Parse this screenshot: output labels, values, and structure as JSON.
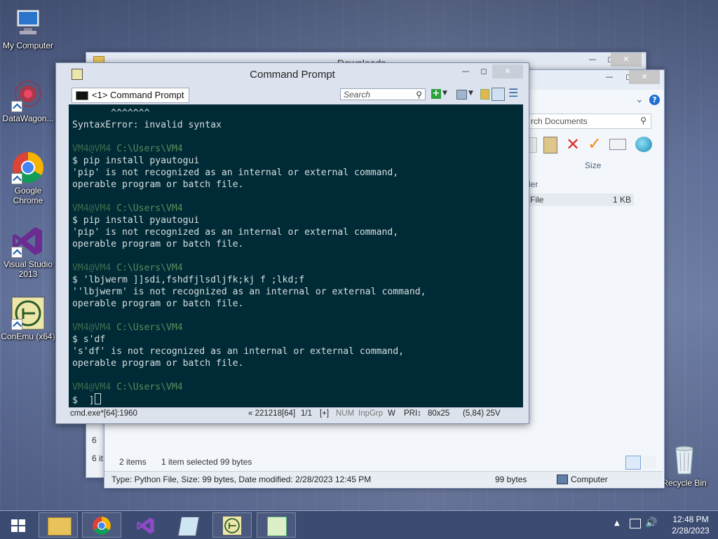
{
  "desktop": {
    "icons": [
      {
        "label": "My Computer",
        "icon": "computer-icon"
      },
      {
        "label": "DataWagon...",
        "icon": "datawagon-icon"
      },
      {
        "label": "Google Chrome",
        "icon": "chrome-icon"
      },
      {
        "label": "Visual Studio 2013",
        "icon": "visual-studio-icon"
      },
      {
        "label": "ConEmu (x64)",
        "icon": "conemu-icon"
      },
      {
        "label": "Recycle Bin",
        "icon": "recycle-bin-icon"
      }
    ]
  },
  "explorer_back": {
    "title": "Downloads",
    "status_items": "6 it",
    "left_label": "6"
  },
  "explorer_front": {
    "search_placeholder": "rch Documents",
    "column_size": "Size",
    "row_group": "ler",
    "row_type": "File",
    "row_size": "1 KB",
    "status_count": "2 items",
    "status_selected": "1 item selected  99 bytes",
    "details_text": "Type: Python File, Size: 99 bytes, Date modified: 2/28/2023 12:45 PM",
    "details_size": "99 bytes",
    "details_location": "Computer"
  },
  "cmd": {
    "title": "Command Prompt",
    "tab_label": "<1> Command Prompt",
    "search_placeholder": "Search",
    "lines": {
      "l1": "       ^^^^^^^",
      "l2": "SyntaxError: invalid syntax",
      "l4_user": "VM4@VM4",
      "l4_path": "C:\\Users\\VM4",
      "l5": "$ pip install pyautogui",
      "l6": "'pip' is not recognized as an internal or external command,",
      "l7": "operable program or batch file.",
      "l9_user": "VM4@VM4",
      "l9_path": "C:\\Users\\VM4",
      "l10": "$ pip install pyautogui",
      "l11": "'pip' is not recognized as an internal or external command,",
      "l12": "operable program or batch file.",
      "l14_user": "VM4@VM4",
      "l14_path": "C:\\Users\\VM4",
      "l15": "$ 'lbjwerm ]]sdi,fshdfjlsdljfk;kj f ;lkd;f",
      "l16": "''lbjwerm' is not recognized as an internal or external command,",
      "l17": "operable program or batch file.",
      "l19_user": "VM4@VM4",
      "l19_path": "C:\\Users\\VM4",
      "l20": "$ s'df",
      "l21": "'s'df' is not recognized as an internal or external command,",
      "l22": "operable program or batch file.",
      "l24_user": "VM4@VM4",
      "l24_path": "C:\\Users\\VM4",
      "l25": "$  ]"
    },
    "status": {
      "process": "cmd.exe*[64]:1960",
      "pid": "« 221218[64]",
      "pos": "1/1",
      "plus": "[+]",
      "num": "NUM",
      "inpgrp": "InpGrp",
      "w": "W",
      "pri": "PRI↕",
      "size": "80x25",
      "cursor": "(5,84) 25V"
    }
  },
  "taskbar": {
    "time": "12:48 PM",
    "date": "2/28/2023",
    "apps": [
      "file-explorer-icon",
      "chrome-icon",
      "visual-studio-icon",
      "notepad-icon",
      "conemu-icon",
      "editor-icon"
    ]
  }
}
